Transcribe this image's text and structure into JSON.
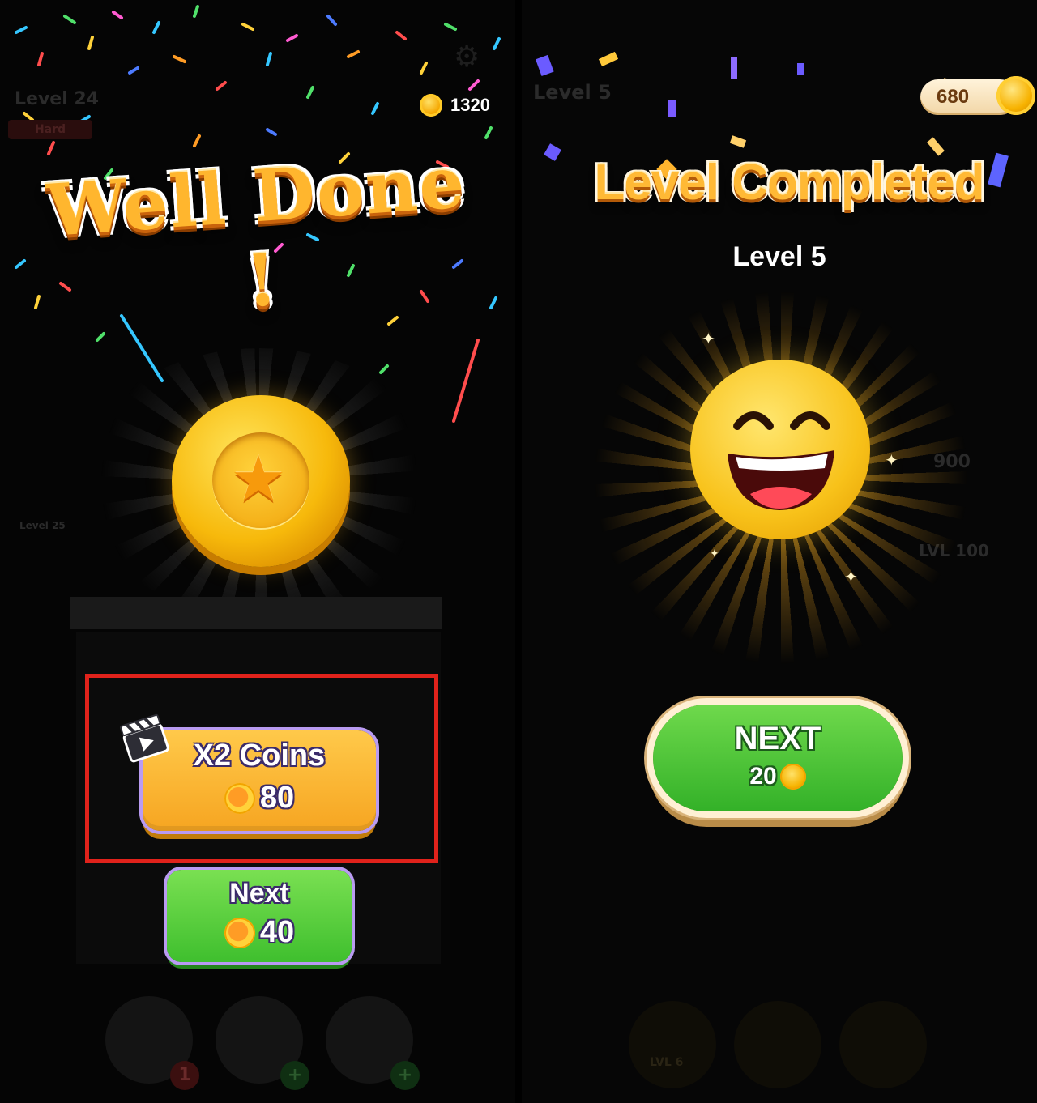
{
  "left_screen": {
    "faded_level": "Level 24",
    "faded_difficulty": "Hard",
    "faded_next_level": "Level 25",
    "coins": "1320",
    "headline": "Well Done !",
    "double_button": {
      "title": "X2 Coins",
      "amount": "80"
    },
    "next_button": {
      "title": "Next",
      "amount": "40"
    },
    "tool_badge_1": "1",
    "tool_badge_plus": "+"
  },
  "right_screen": {
    "faded_level": "Level 5",
    "coins": "680",
    "headline": "Level Completed",
    "level_label": "Level 5",
    "next_button": {
      "title": "NEXT",
      "amount": "20"
    },
    "faded_goal_value": "900",
    "faded_lock_label": "LVL 100",
    "faded_bottom_lock": "LVL 6"
  },
  "colors": {
    "highlight_border": "#e0221b",
    "coin_gold": "#f7b90b",
    "next_green": "#3fbf2e",
    "button_orange": "#f6a521"
  },
  "icons": [
    "settings-gear-icon",
    "coin-icon",
    "star-icon",
    "video-clapper-icon",
    "smiling-emoji-icon",
    "lock-icon"
  ]
}
